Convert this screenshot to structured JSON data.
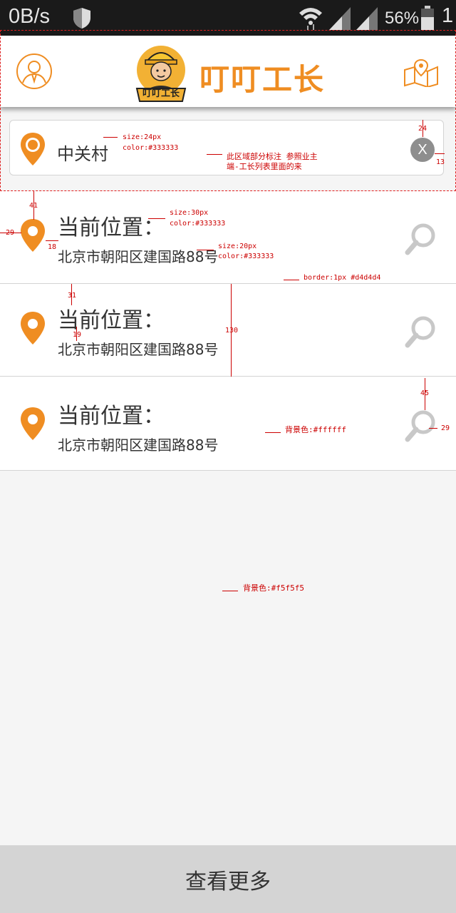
{
  "status_bar": {
    "speed": "0B/s",
    "battery": "56%",
    "time": "1"
  },
  "header": {
    "brand_title": "叮叮工长",
    "logo_caption": "叮叮工长"
  },
  "search": {
    "location_text": "中关村",
    "clear_label": "X"
  },
  "list": {
    "items": [
      {
        "title": "当前位置：",
        "address": "北京市朝阳区建国路88号"
      },
      {
        "title": "当前位置：",
        "address": "北京市朝阳区建国路88号"
      },
      {
        "title": "当前位置：",
        "address": "北京市朝阳区建国路88号"
      }
    ]
  },
  "footer": {
    "more_label": "查看更多"
  },
  "annotations": {
    "search_font": "size:24px",
    "search_color": "color:#333333",
    "region_note_1": "此区域部分标注 参照业主",
    "region_note_2": "端-工长列表里面的来",
    "gap_24": "24",
    "gap_13": "13",
    "gap_41": "41",
    "gap_29a": "29",
    "gap_18": "18",
    "title_font": "size:30px",
    "title_color": "color:#333333",
    "addr_font": "size:20px",
    "addr_color": "color:#333333",
    "border_note": "border:1px #d4d4d4",
    "gap_31": "31",
    "gap_19": "19",
    "height_130": "130",
    "gap_45": "45",
    "gap_29b": "29",
    "bg_white": "背景色:#ffffff",
    "bg_gray": "背景色:#f5f5f5"
  },
  "colors": {
    "accent": "#ef8d22",
    "text": "#333333",
    "border": "#d4d4d4",
    "bg": "#f5f5f5"
  }
}
